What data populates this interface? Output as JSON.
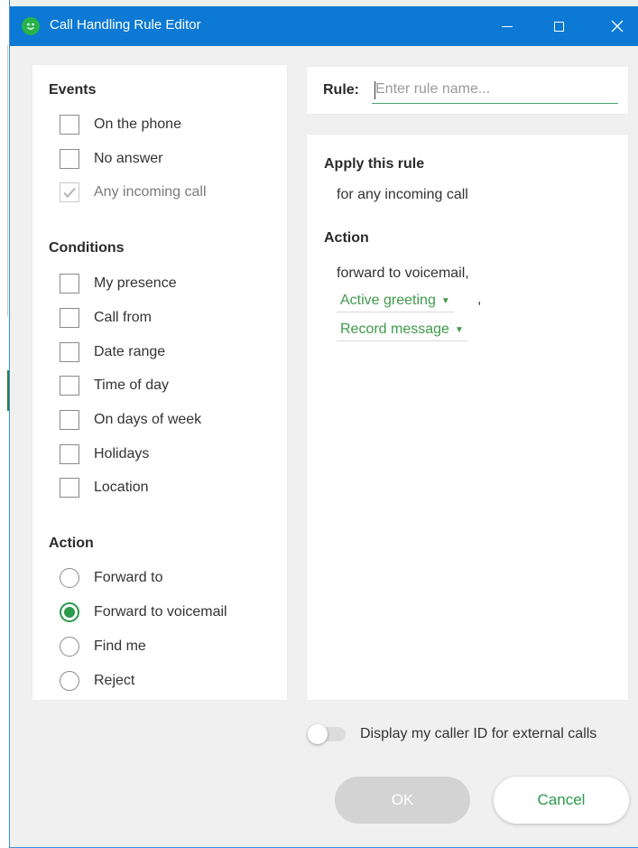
{
  "window": {
    "title": "Call Handling Rule Editor",
    "app_icon_text": "😊",
    "accent_color": "#0c79d4",
    "brand_green": "#2c9a4b"
  },
  "events": {
    "title": "Events",
    "items": [
      {
        "label": "On the phone",
        "checked": false,
        "disabled": false
      },
      {
        "label": "No answer",
        "checked": false,
        "disabled": false
      },
      {
        "label": "Any incoming call",
        "checked": true,
        "disabled": true
      }
    ]
  },
  "conditions": {
    "title": "Conditions",
    "items": [
      {
        "label": "My presence",
        "checked": false
      },
      {
        "label": "Call from",
        "checked": false
      },
      {
        "label": "Date range",
        "checked": false
      },
      {
        "label": "Time of day",
        "checked": false
      },
      {
        "label": "On days of week",
        "checked": false
      },
      {
        "label": "Holidays",
        "checked": false
      },
      {
        "label": "Location",
        "checked": false
      }
    ]
  },
  "action": {
    "title": "Action",
    "options": [
      {
        "label": "Forward to",
        "selected": false
      },
      {
        "label": "Forward to voicemail",
        "selected": true
      },
      {
        "label": "Find me",
        "selected": false
      },
      {
        "label": "Reject",
        "selected": false
      }
    ]
  },
  "rule": {
    "label": "Rule:",
    "value": "",
    "placeholder": "Enter rule name..."
  },
  "summary": {
    "apply_heading": "Apply this rule",
    "apply_text": "for any incoming call",
    "action_heading": "Action",
    "action_text": "forward to voicemail,",
    "greeting_dropdown": "Active greeting",
    "greeting_suffix": ",",
    "message_dropdown": "Record message"
  },
  "caller_id_toggle": {
    "label": "Display my caller ID for external calls",
    "on": false
  },
  "buttons": {
    "ok": "OK",
    "cancel": "Cancel"
  }
}
